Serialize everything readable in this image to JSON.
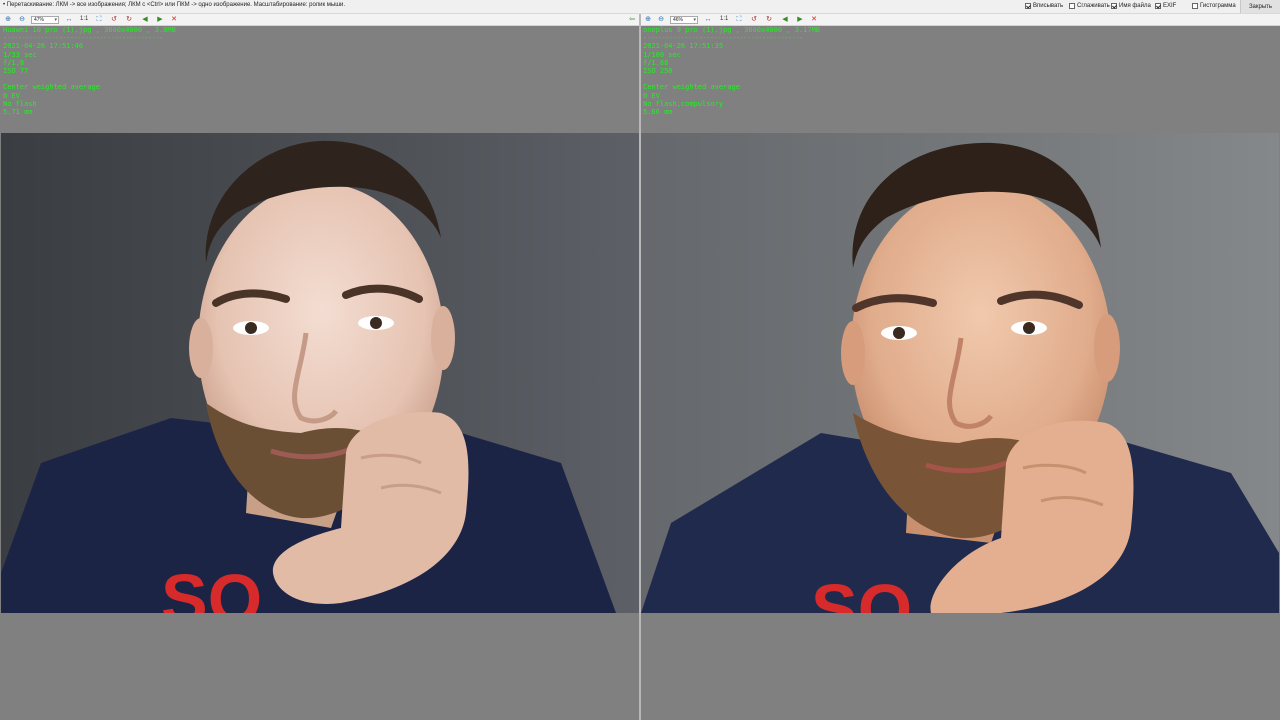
{
  "topbar": {
    "hint": "• Перетаскивание: ЛКМ -> все изображения; ЛКМ с <Ctrl> или ПКМ -> одно изображение. Масштабирование: ролик мыши.",
    "options": [
      {
        "label": "Вписывать",
        "checked": true
      },
      {
        "label": "Сглаживать",
        "checked": false
      },
      {
        "label": "Имя файла",
        "checked": true
      },
      {
        "label": "EXIF",
        "checked": true
      },
      {
        "label": "Гистограмма",
        "checked": false
      }
    ],
    "close_label": "Закрыть"
  },
  "left": {
    "zoom": "47%",
    "one_to_one": "1:1",
    "file_line": "Huawei 10 pro (1).jpg , 3000x4000 , 3.8MB",
    "separator": "-------------------------------------------",
    "date": "2021-04-26 17:51:46",
    "exposure": "1/33 sec",
    "aperture": "f/1.8",
    "iso": "ISO 77",
    "metering": "Center weighted average",
    "ev": "0 EV",
    "flash": "No flash",
    "focal": "5.71 mm"
  },
  "right": {
    "zoom": "46%",
    "one_to_one": "1:1",
    "file_line": "oneplus 9 pro (1).jpg , 3000x4000 , 3.17MB",
    "separator": "-------------------------------------------",
    "date": "2021-04-26 17:51:35",
    "exposure": "1/100 sec",
    "aperture": "f/1.88",
    "iso": "ISO 250",
    "metering": "Center weighted average",
    "ev": "0 EV",
    "flash": "No flash,compulsory",
    "focal": "5.66 mm"
  },
  "toolbar_icons": [
    "zoom-in-icon",
    "zoom-out-icon",
    "fit-icon",
    "rotate-left-icon",
    "rotate-right-icon",
    "prev-icon",
    "next-icon",
    "delete-icon"
  ],
  "colors": {
    "exif_text": "#22ee22",
    "pane_bg": "#808080",
    "shirt": "#1c2446",
    "shirt_logo": "#d72a2a"
  }
}
